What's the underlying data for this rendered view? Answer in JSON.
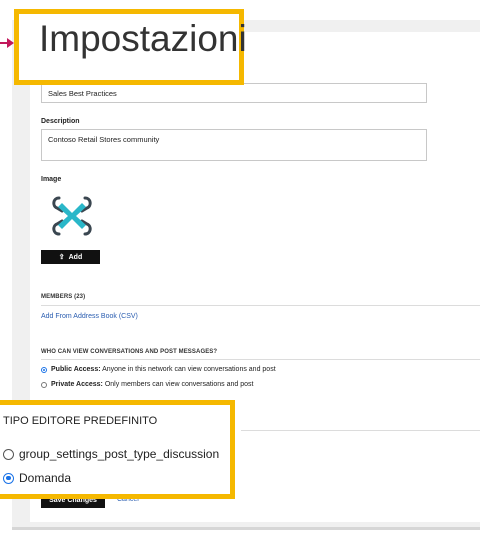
{
  "page_title": "Impostazioni",
  "name_field": {
    "value": "Sales Best Practices"
  },
  "description": {
    "label": "Description",
    "value": "Contoso Retail Stores community"
  },
  "image": {
    "label": "Image",
    "logo_icon": "contoso-drone-logo",
    "add_label": "Add",
    "add_icon": "upload-icon"
  },
  "members": {
    "heading": "MEMBERS (23)",
    "add_link": "Add From Address Book (CSV)"
  },
  "view_access": {
    "heading": "WHO CAN VIEW CONVERSATIONS AND POST MESSAGES?",
    "options": [
      {
        "bold": "Public Access:",
        "text": " Anyone in this network can view conversations and post",
        "selected": true
      },
      {
        "bold": "Private Access:",
        "text": " Only members can view conversations and post",
        "selected": false
      }
    ]
  },
  "default_editor": {
    "heading": "TIPO EDITORE PREDEFINITO",
    "options": [
      {
        "label": "group_settings_post_type_discussion",
        "selected": false
      },
      {
        "label": "Domanda",
        "selected": true
      }
    ]
  },
  "actions": {
    "save_label": "Save Changes",
    "cancel_label": "Cancel"
  },
  "colors": {
    "highlight": "#f5b800",
    "arrow": "#c2185b",
    "radio_selected": "#1a73e8",
    "link": "#2a5db0"
  }
}
